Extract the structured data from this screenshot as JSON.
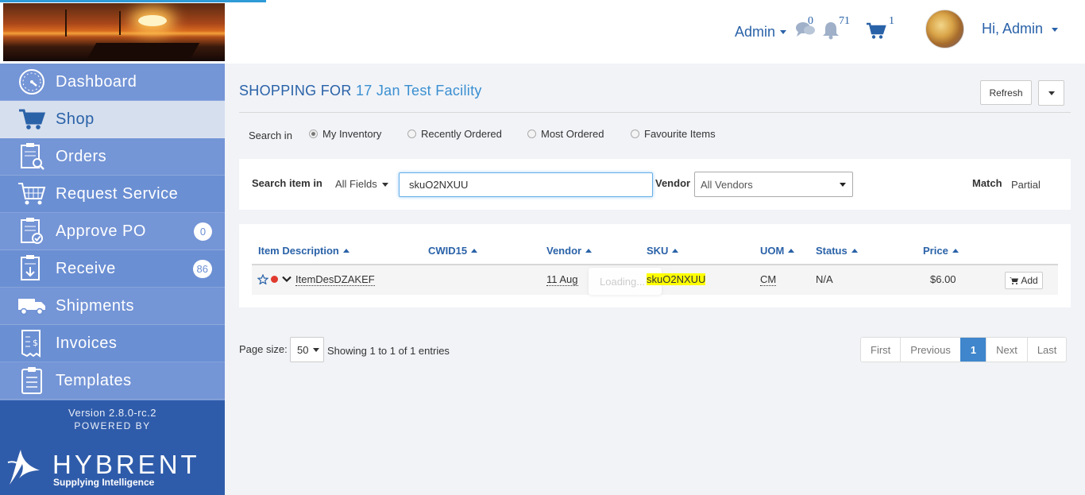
{
  "header": {
    "admin_menu_label": "Admin",
    "messages_count": "0",
    "notifications_count": "71",
    "cart_count": "1",
    "greeting": "Hi, Admin"
  },
  "sidebar": {
    "items": [
      {
        "label": "Dashboard",
        "icon": "dashboard-gauge-icon"
      },
      {
        "label": "Shop",
        "icon": "shopping-cart-icon",
        "active": true
      },
      {
        "label": "Orders",
        "icon": "clipboard-search-icon"
      },
      {
        "label": "Request Service",
        "icon": "service-cart-icon"
      },
      {
        "label": "Approve PO",
        "icon": "clipboard-check-icon",
        "badge": "0"
      },
      {
        "label": "Receive",
        "icon": "clipboard-download-icon",
        "badge": "86"
      },
      {
        "label": "Shipments",
        "icon": "truck-icon"
      },
      {
        "label": "Invoices",
        "icon": "invoice-dollar-icon"
      },
      {
        "label": "Templates",
        "icon": "template-clipboard-icon"
      }
    ],
    "version": "Version 2.8.0-rc.2",
    "powered_by": "POWERED BY",
    "brand_name": "HYBRENT",
    "brand_tagline": "Supplying Intelligence"
  },
  "main": {
    "title_prefix": "SHOPPING FOR",
    "facility": "17 Jan Test Facility",
    "refresh_label": "Refresh",
    "search_in_label": "Search in",
    "search_options": [
      "My Inventory",
      "Recently Ordered",
      "Most Ordered",
      "Favourite Items"
    ],
    "search_item_in_label": "Search item in",
    "field_scope": "All Fields",
    "search_value": "skuO2NXUU",
    "vendor_label": "Vendor",
    "vendor_selected": "All Vendors",
    "match_label": "Match",
    "match_value": "Partial"
  },
  "table": {
    "columns": [
      "Item Description",
      "CWID15",
      "Vendor",
      "SKU",
      "UOM",
      "Status",
      "Price"
    ],
    "rows": [
      {
        "description": "ItemDesDZAKEF",
        "cwid15": "",
        "vendor": "11 Aug",
        "sku": "skuO2NXUU",
        "uom": "CM",
        "status": "N/A",
        "price": "$6.00",
        "action": "Add"
      }
    ],
    "loading_text": "Loading..."
  },
  "footer": {
    "page_size_label": "Page size:",
    "page_size": "50",
    "entries_text": "Showing 1 to 1 of 1 entries",
    "pager": [
      "First",
      "Previous",
      "1",
      "Next",
      "Last"
    ]
  },
  "colors": {
    "accent": "#2a62a8",
    "sidebar": "#6b8fd3",
    "highlight": "#ffff00",
    "pager_active": "#3f86cc"
  }
}
